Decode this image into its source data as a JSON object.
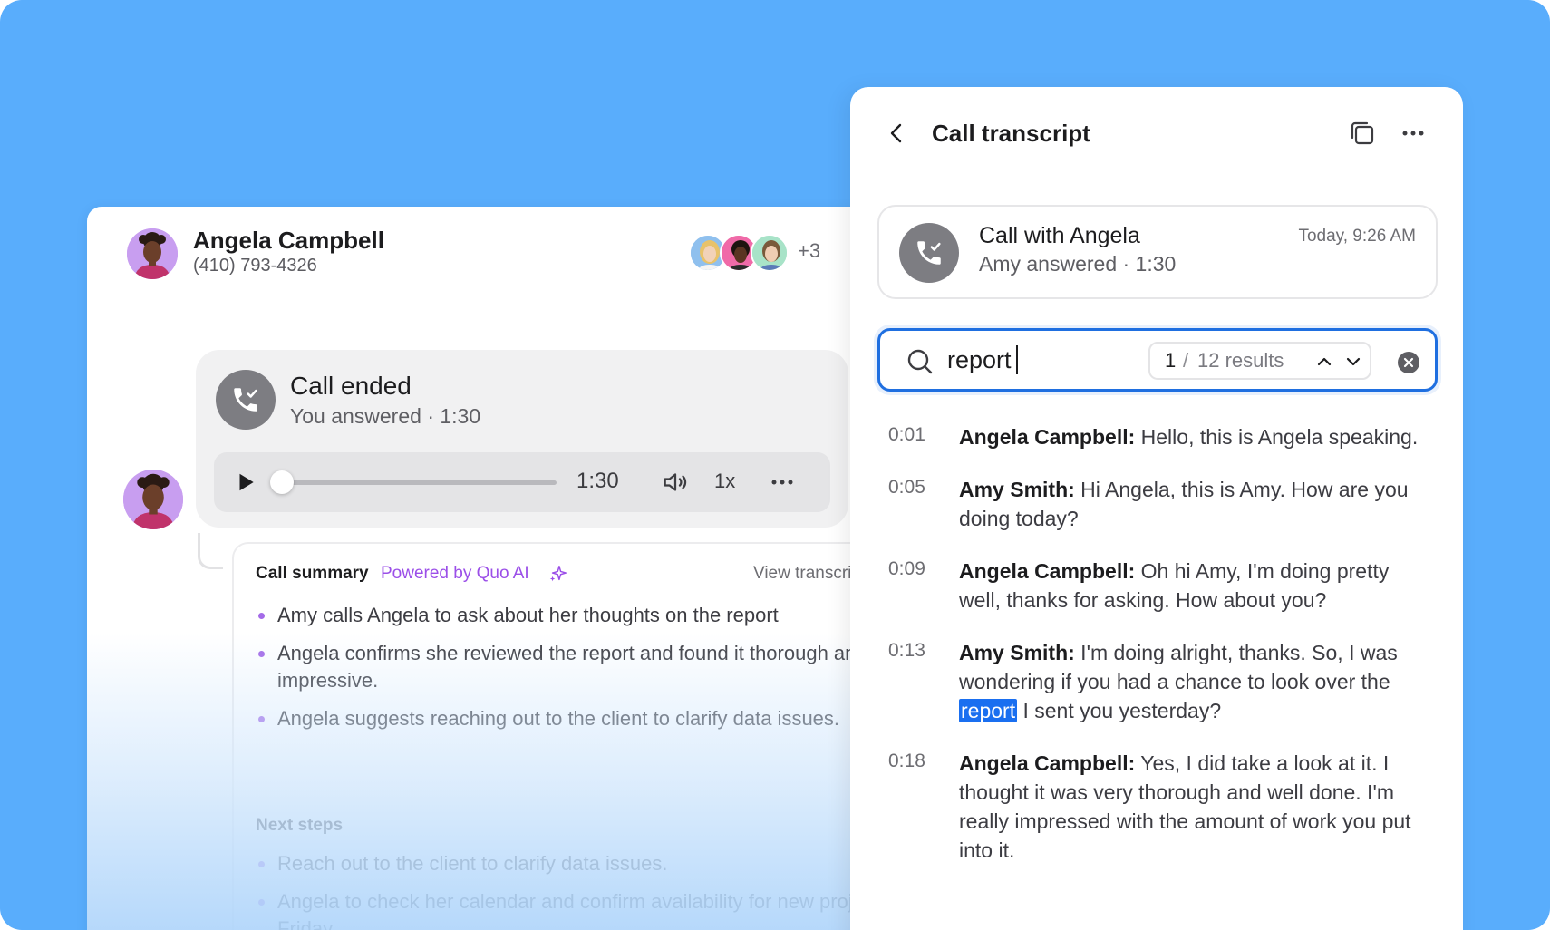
{
  "contact": {
    "name": "Angela Campbell",
    "phone": "(410) 793-4326",
    "participants_more": "+3"
  },
  "call_card": {
    "title": "Call ended",
    "subtitle": "You answered · 1:30",
    "player": {
      "time": "1:30",
      "speed": "1x",
      "progress": 0.0
    }
  },
  "summary": {
    "heading": "Call summary",
    "powered_by": "Powered by Quo AI",
    "view_link": "View transcript",
    "bullets": [
      "Amy calls Angela to ask about her thoughts on the report",
      "Angela confirms she reviewed the report and found it thorough and impressive.",
      "Angela suggests reaching out to the client to clarify data issues."
    ],
    "next_steps_heading": "Next steps",
    "next_steps": [
      "Reach out to the client to clarify data issues.",
      "Angela to check her calendar and confirm availability for new project on Friday."
    ]
  },
  "transcript": {
    "title": "Call transcript",
    "call": {
      "title": "Call with Angela",
      "subtitle": "Amy answered · 1:30",
      "time": "Today, 9:26 AM"
    },
    "search": {
      "value": "report",
      "current": "1",
      "sep": "/",
      "total": "12 results"
    },
    "lines": [
      {
        "time": "0:01",
        "speaker": "Angela Campbell:",
        "text": " Hello, this is Angela speaking."
      },
      {
        "time": "0:05",
        "speaker": "Amy Smith:",
        "text": " Hi Angela, this is Amy. How are you doing today?"
      },
      {
        "time": "0:09",
        "speaker": "Angela Campbell:",
        "text": " Oh hi Amy, I'm doing pretty well, thanks for asking. How about you?"
      },
      {
        "time": "0:13",
        "speaker": "Amy Smith:",
        "text_before": " I'm doing alright, thanks. So, I was wondering if you had a chance to look over the ",
        "highlight": "report",
        "text_after": " I sent you yesterday?"
      },
      {
        "time": "0:18",
        "speaker": "Angela Campbell:",
        "text": " Yes, I did take a look at it. I thought it was very thorough and well done. I'm really impressed with the amount of work you put into it."
      }
    ]
  },
  "colors": {
    "background": "#59adfc",
    "accent": "#1f6fe0",
    "highlight": "#1a6ff0",
    "ai_purple": "#9b4fe8",
    "call_icon_bg": "#7d7d82"
  },
  "icons": [
    "back-icon",
    "copy-icon",
    "more-icon",
    "phone-answered-icon",
    "search-icon",
    "chevron-up-icon",
    "chevron-down-icon",
    "clear-icon",
    "play-icon",
    "volume-icon",
    "sparkle-icon"
  ]
}
